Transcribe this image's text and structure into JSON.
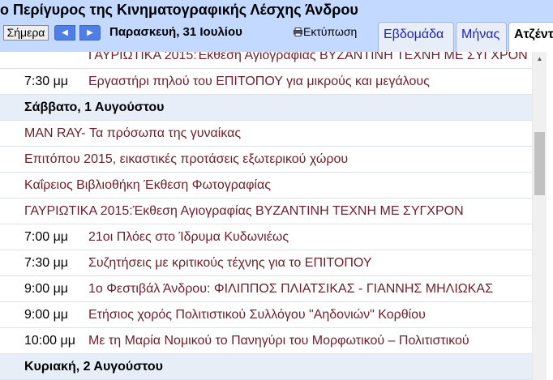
{
  "header": {
    "title": "ο Περίγυρος της Κινηματογραφικής Λέσχης Άνδρου",
    "today_label": "Σήμερα",
    "prev_icon": "◀",
    "next_icon": "▶",
    "current_date": "Παρασκευή, 31 Ιουλίου",
    "print_label": "Εκτύπωση",
    "tabs": [
      "Εβδομάδα",
      "Μήνας",
      "Ατζέντα"
    ]
  },
  "agenda": [
    {
      "type": "event",
      "time": "",
      "title": "ΓΑΥΡΙΩΤΙΚΑ 2015:Έκθεση Αγιογραφίας ΒΥΖΑΝΤΙΝΗ ΤΕΧΝΗ ΜΕ ΣΥΓΧΡΟΝ"
    },
    {
      "type": "event",
      "time": "7:30 μμ",
      "title": "Εργαστήρι πηλού του ΕΠΙΤΟΠΟΥ για μικρούς και μεγάλους"
    },
    {
      "type": "day",
      "label": "Σάββατο, 1 Αυγούστου"
    },
    {
      "type": "event",
      "time": "",
      "title": "MAN RAY- Τα πρόσωπα της γυναίκας"
    },
    {
      "type": "event",
      "time": "",
      "title": "Επιτόπου 2015, εικαστικές προτάσεις εξωτερικού χώρου"
    },
    {
      "type": "event",
      "time": "",
      "title": "Καΐρειος Βιβλιοθήκη Έκθεση Φωτογραφίας"
    },
    {
      "type": "event",
      "time": "",
      "title": "ΓΑΥΡΙΩΤΙΚΑ 2015:Έκθεση Αγιογραφίας ΒΥΖΑΝΤΙΝΗ ΤΕΧΝΗ ΜΕ ΣΥΓΧΡΟΝ"
    },
    {
      "type": "event",
      "time": "7:00 μμ",
      "title": "21οι Πλόες στο Ίδρυμα Κυδωνιέως"
    },
    {
      "type": "event",
      "time": "7:30 μμ",
      "title": "Συζητήσεις με κριτικούς τέχνης για το ΕΠΙΤΟΠΟΥ"
    },
    {
      "type": "event",
      "time": "9:00 μμ",
      "title": "1ο Φεστιβάλ Άνδρου: ΦΙΛΙΠΠΟΣ ΠΛΙΑΤΣΙΚΑΣ - ΓΙΑΝΝΗΣ ΜΗΛΙΩΚΑΣ"
    },
    {
      "type": "event",
      "time": "9:00 μμ",
      "title": "Ετήσιος χορός Πολιτιστικού Συλλόγου \"Αηδονιών\" Κορθίου"
    },
    {
      "type": "event",
      "time": "10:00 μμ",
      "title": "Με τη Μαρία Νομικού το Πανηγύρι του Μορφωτικού – Πολιτιστικού"
    },
    {
      "type": "day",
      "label": "Κυριακή, 2 Αυγούστου"
    }
  ],
  "colors": {
    "header_bg": "#c3d9ff",
    "day_header_bg": "#e8eef7",
    "event_text": "#6b1f2a",
    "tab_text": "#2020c0",
    "nav_button": "#4f7fe6"
  }
}
